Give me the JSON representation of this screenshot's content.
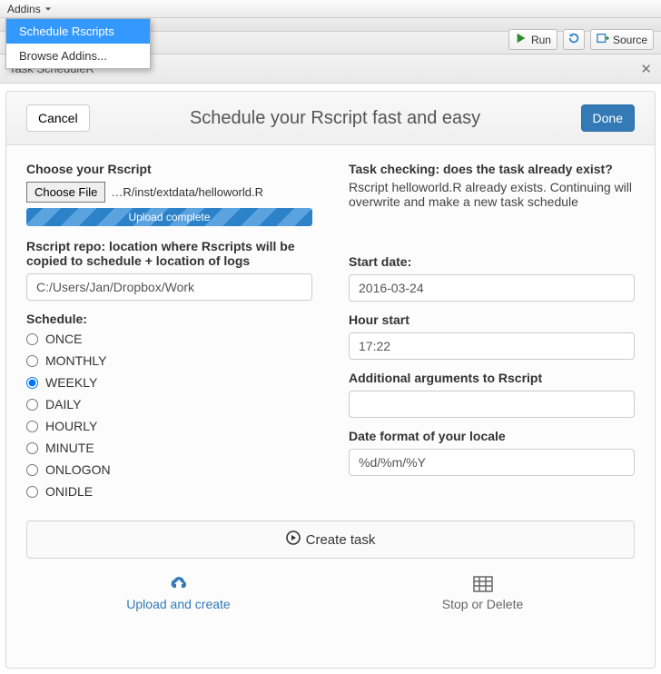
{
  "menubar": {
    "addins_label": "Addins"
  },
  "dropdown": {
    "schedule_label": "Schedule Rscripts",
    "browse_label": "Browse Addins..."
  },
  "toolbar": {
    "run_label": "Run",
    "source_label": "Source"
  },
  "panel": {
    "title": "Task ScheduleR"
  },
  "dialog": {
    "cancel_label": "Cancel",
    "done_label": "Done",
    "title": "Schedule your Rscript fast and easy"
  },
  "left": {
    "choose_label": "Choose your Rscript",
    "choose_file_button": "Choose File",
    "file_path": "…R/inst/extdata/helloworld.R",
    "upload_status": "Upload complete",
    "repo_label": "Rscript repo: location where Rscripts will be copied to schedule + location of logs",
    "repo_value": "C:/Users/Jan/Dropbox/Work",
    "schedule_label": "Schedule:",
    "schedule_options": [
      "ONCE",
      "MONTHLY",
      "WEEKLY",
      "DAILY",
      "HOURLY",
      "MINUTE",
      "ONLOGON",
      "ONIDLE"
    ],
    "schedule_selected": "WEEKLY"
  },
  "right": {
    "checking_title": "Task checking: does the task already exist?",
    "checking_body": "Rscript helloworld.R already exists. Continuing will overwrite and make a new task schedule",
    "start_date_label": "Start date:",
    "start_date_value": "2016-03-24",
    "hour_label": "Hour start",
    "hour_value": "17:22",
    "args_label": "Additional arguments to Rscript",
    "args_value": "",
    "locale_label": "Date format of your locale",
    "locale_value": "%d/%m/%Y"
  },
  "create": {
    "label": "Create task"
  },
  "footer": {
    "upload_label": "Upload and create",
    "stop_label": "Stop or Delete"
  }
}
